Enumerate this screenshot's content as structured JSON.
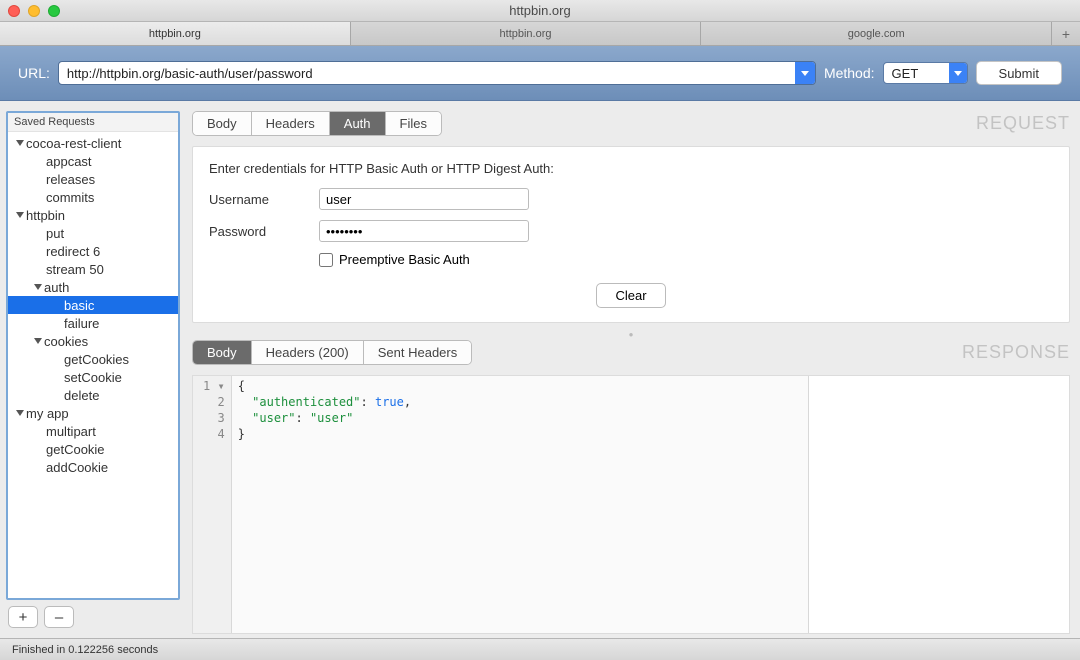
{
  "window_title": "httpbin.org",
  "tabs": [
    {
      "label": "httpbin.org",
      "active": true
    },
    {
      "label": "httpbin.org",
      "active": false
    },
    {
      "label": "google.com",
      "active": false
    }
  ],
  "urlbar": {
    "url_label": "URL:",
    "url_value": "http://httpbin.org/basic-auth/user/password",
    "method_label": "Method:",
    "method_value": "GET",
    "submit_label": "Submit"
  },
  "sidebar": {
    "header": "Saved Requests",
    "tree": [
      {
        "label": "cocoa-rest-client",
        "indent": 0,
        "expandable": true
      },
      {
        "label": "appcast",
        "indent": 1
      },
      {
        "label": "releases",
        "indent": 1
      },
      {
        "label": "commits",
        "indent": 1
      },
      {
        "label": "httpbin",
        "indent": 0,
        "expandable": true
      },
      {
        "label": "put",
        "indent": 1
      },
      {
        "label": "redirect 6",
        "indent": 1
      },
      {
        "label": "stream 50",
        "indent": 1
      },
      {
        "label": "auth",
        "indent": 1,
        "expandable": true
      },
      {
        "label": "basic",
        "indent": 2,
        "selected": true
      },
      {
        "label": "failure",
        "indent": 2
      },
      {
        "label": "cookies",
        "indent": 1,
        "expandable": true
      },
      {
        "label": "getCookies",
        "indent": 2
      },
      {
        "label": "setCookie",
        "indent": 2
      },
      {
        "label": "delete",
        "indent": 2
      },
      {
        "label": "my app",
        "indent": 0,
        "expandable": true
      },
      {
        "label": "multipart",
        "indent": 1
      },
      {
        "label": "getCookie",
        "indent": 1
      },
      {
        "label": "addCookie",
        "indent": 1
      }
    ],
    "add_label": "+",
    "remove_label": "–"
  },
  "request": {
    "title": "REQUEST",
    "tabs": [
      "Body",
      "Headers",
      "Auth",
      "Files"
    ],
    "active_tab": "Auth",
    "instructions": "Enter credentials for HTTP Basic Auth or HTTP Digest Auth:",
    "username_label": "Username",
    "username_value": "user",
    "password_label": "Password",
    "password_value": "••••••••",
    "checkbox_label": "Preemptive Basic Auth",
    "checkbox_checked": false,
    "clear_label": "Clear"
  },
  "response": {
    "title": "RESPONSE",
    "tabs": [
      "Body",
      "Headers (200)",
      "Sent Headers"
    ],
    "active_tab": "Body",
    "body_lines": [
      "{",
      "  \"authenticated\": true,",
      "  \"user\": \"user\"",
      "}"
    ],
    "body_json": {
      "authenticated": true,
      "user": "user"
    }
  },
  "status_text": "Finished in 0.122256 seconds"
}
